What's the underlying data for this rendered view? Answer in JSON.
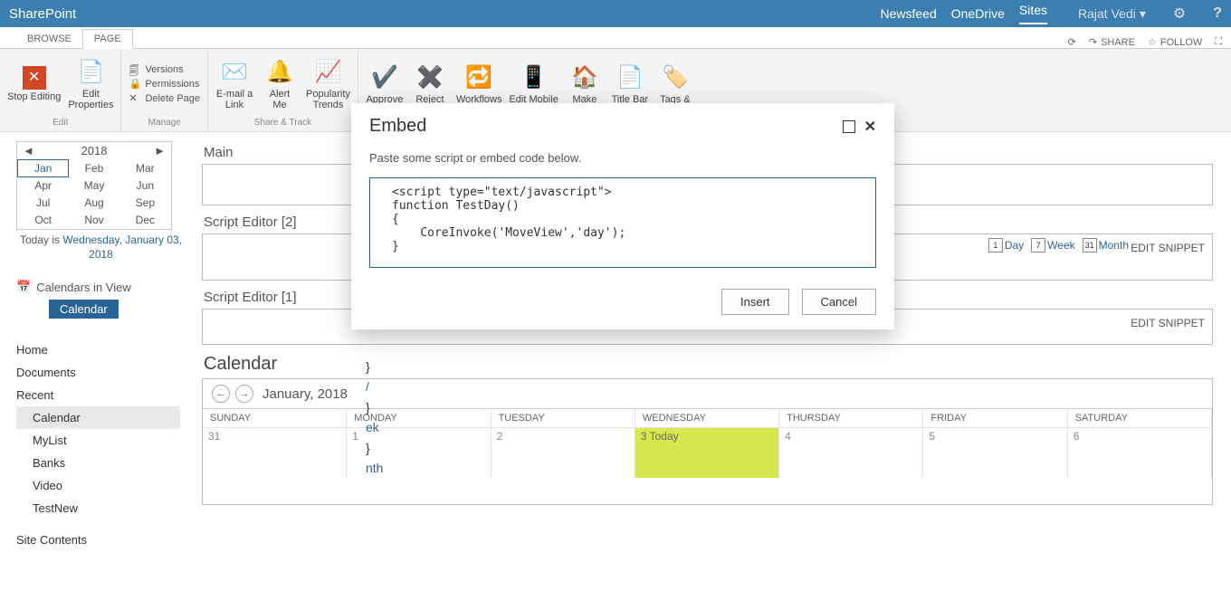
{
  "topbar": {
    "brand": "SharePoint",
    "links": {
      "newsfeed": "Newsfeed",
      "onedrive": "OneDrive",
      "sites": "Sites"
    },
    "user": "Rajat Vedi"
  },
  "tabs": {
    "browse": "BROWSE",
    "page": "PAGE"
  },
  "sharefollow": {
    "share": "SHARE",
    "follow": "FOLLOW"
  },
  "ribbon": {
    "edit": {
      "stop": "Stop Editing",
      "props": "Edit\nProperties",
      "group": "Edit"
    },
    "manage": {
      "versions": "Versions",
      "perms": "Permissions",
      "delete": "Delete Page",
      "group": "Manage"
    },
    "share": {
      "email": "E-mail a\nLink",
      "alert": "Alert\nMe",
      "trends": "Popularity\nTrends",
      "group": "Share & Track"
    },
    "approve": "Approve",
    "reject": "Reject",
    "workflows": "Workflows",
    "editmobile": "Edit Mobile",
    "make": "Make",
    "titlebar": "Title Bar",
    "tags": "Tags &"
  },
  "calpick": {
    "year": "2018",
    "months": [
      [
        "Jan",
        "Feb",
        "Mar"
      ],
      [
        "Apr",
        "May",
        "Jun"
      ],
      [
        "Jul",
        "Aug",
        "Sep"
      ],
      [
        "Oct",
        "Nov",
        "Dec"
      ]
    ],
    "cur": "Jan",
    "today_pre": "Today is ",
    "today_link": "Wednesday, January 03, 2018"
  },
  "civ": {
    "label": "Calendars in View",
    "btn": "Calendar"
  },
  "nav": {
    "items": [
      "Home",
      "Documents",
      "Recent"
    ],
    "sub": [
      "Calendar",
      "MyList",
      "Banks",
      "Video",
      "TestNew"
    ],
    "tail": "Site Contents"
  },
  "main": {
    "title": "Main",
    "se2": "Script Editor [2]",
    "se1": "Script Editor [1]",
    "snippet": "EDIT SNIPPET",
    "views": {
      "day": "Day",
      "week": "Week",
      "month": "Month",
      "d1": "1",
      "d7": "7",
      "d31": "31"
    },
    "cal": {
      "title": "Calendar",
      "month": "January, 2018",
      "days": [
        "SUNDAY",
        "MONDAY",
        "TUESDAY",
        "WEDNESDAY",
        "THURSDAY",
        "FRIDAY",
        "SATURDAY"
      ],
      "row1": [
        "31",
        "1",
        "2",
        "3 Today",
        "4",
        "5",
        "6"
      ]
    }
  },
  "modal": {
    "title": "Embed",
    "instr": "Paste some script or embed code below.",
    "code": "<script type=\"text/javascript\">\nfunction TestDay()\n{\n    CoreInvoke('MoveView','day');\n}",
    "insert": "Insert",
    "cancel": "Cancel"
  },
  "leak": {
    "l1": "}",
    "l2": "/",
    "l3": "}",
    "l4": "ek",
    "l5": "}",
    "l6": "nth"
  }
}
